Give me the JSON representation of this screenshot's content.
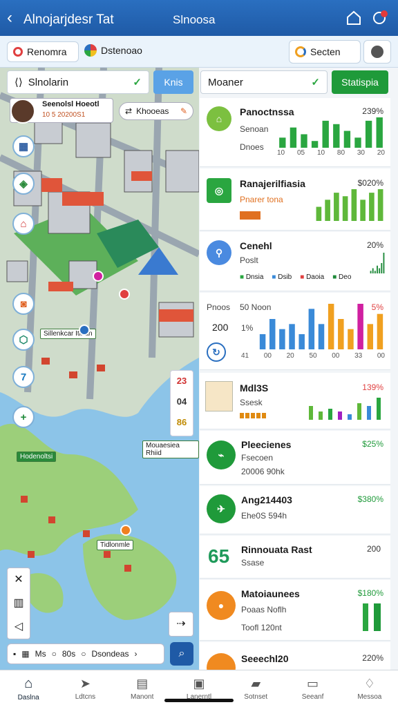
{
  "header": {
    "back_icon": "chevron-left-icon",
    "title": "Alnojarjdesr Tat",
    "center_title": "Slnoosa",
    "home_icon": "home-icon",
    "bell_icon": "notification-icon"
  },
  "toolbar": {
    "tab1": "Renomra",
    "tab2": "Dstenoao",
    "search_label": "Secten",
    "record_icon": "record-icon"
  },
  "map_controls": {
    "location_field": "Slnolarin",
    "apply_button": "Knis",
    "profile_name": "Seenolsl Hoeotl",
    "profile_stats": "10 5 20200S1",
    "filter_chip": "Khooeas"
  },
  "metric_controls": {
    "metric_field": "Moaner",
    "stats_button": "Statispia"
  },
  "map_labels": {
    "label1": "Sillenkcar Itinan",
    "label2": "Hodenoltsi",
    "label3": "Tidlonmle",
    "side_numbers": [
      "23",
      "04",
      "86"
    ],
    "place_label": "Mouaesiea Rhiid"
  },
  "map_side_icons": [
    "building-icon",
    "tag-icon",
    "shop-icon",
    "bag-icon",
    "shield-icon",
    "seven-icon",
    "plus-icon"
  ],
  "map_search": {
    "opt1": "Ms",
    "opt2": "80s",
    "opt3": "Dsondeas"
  },
  "cards_top": [
    {
      "title": "Panoctnssa",
      "line1": "Senoan",
      "line2": "Dnoes",
      "value": "239%",
      "ticks": [
        "10",
        "05",
        "10",
        "80",
        "30",
        "20"
      ],
      "color": "#2aa640",
      "bars": [
        3,
        6,
        4,
        2,
        8,
        7,
        5,
        3,
        8,
        9
      ]
    },
    {
      "title": "Ranajerilfiasia",
      "line1": "Pnarer tona",
      "value": "$020%",
      "color": "#5fb83a",
      "bars": [
        4,
        6,
        8,
        7,
        9,
        6,
        8,
        9
      ]
    },
    {
      "title": "Cenehl",
      "line1": "Poslt",
      "value": "20%",
      "legend": [
        "Dnsia",
        "Dsib",
        "Daoia",
        "Deo"
      ],
      "color": "#1f8a3a",
      "bars": [
        1,
        2,
        1,
        3,
        2,
        4,
        8
      ]
    },
    {
      "title": "Pnoos",
      "subtitle": "50 Noon",
      "left1": "200",
      "left2": "1%",
      "value": "5%",
      "ticks": [
        "41",
        "00",
        "20",
        "50",
        "00",
        "33",
        "00"
      ],
      "bars": [
        {
          "v": 3,
          "c": "#3a8ad8"
        },
        {
          "v": 6,
          "c": "#3a8ad8"
        },
        {
          "v": 4,
          "c": "#3a8ad8"
        },
        {
          "v": 5,
          "c": "#3a8ad8"
        },
        {
          "v": 3,
          "c": "#3a8ad8"
        },
        {
          "v": 8,
          "c": "#3a8ad8"
        },
        {
          "v": 5,
          "c": "#3a8ad8"
        },
        {
          "v": 9,
          "c": "#f0a020"
        },
        {
          "v": 6,
          "c": "#f0a020"
        },
        {
          "v": 4,
          "c": "#f0a020"
        },
        {
          "v": 9,
          "c": "#d020a0"
        },
        {
          "v": 5,
          "c": "#f0a020"
        },
        {
          "v": 7,
          "c": "#f0a020"
        }
      ]
    }
  ],
  "cards_bottom": [
    {
      "title": "Mdl3S",
      "line1": "Ssesk",
      "value": "139%",
      "value_color": "#e04040",
      "icon": "temple-icon"
    },
    {
      "title": "Pleecienes",
      "line1": "Fsecoen",
      "line2": "20006 90hk",
      "value": "$25%",
      "icon": "chart-line-icon",
      "icon_color": "#1f9a3a"
    },
    {
      "title": "Ang214403",
      "line1": "Ehe0S 594h",
      "value": "$380%",
      "icon": "plane-icon",
      "icon_color": "#1f9a3a"
    },
    {
      "big": "65",
      "title": "Rinnouata Rast",
      "line1": "Ssase",
      "value": "200"
    },
    {
      "title": "Matoiaunees",
      "line1": "Poaas Noflh",
      "line2": "Toofl 120nt",
      "value": "$180%",
      "icon": "coin-icon",
      "icon_color": "#f08a20"
    },
    {
      "title": "Seeechl20",
      "value": "220%",
      "icon": "circle-icon",
      "icon_color": "#f08a20"
    }
  ],
  "bottom_nav": [
    {
      "label": "Daslna",
      "icon": "home-icon"
    },
    {
      "label": "Ldtcns",
      "icon": "send-icon"
    },
    {
      "label": "Manont",
      "icon": "document-icon"
    },
    {
      "label": "Lanerntl",
      "icon": "clipboard-icon"
    },
    {
      "label": "Sotnset",
      "icon": "bookmark-icon"
    },
    {
      "label": "Seeanf",
      "icon": "inbox-icon"
    },
    {
      "label": "Messoa",
      "icon": "bell-icon"
    }
  ]
}
